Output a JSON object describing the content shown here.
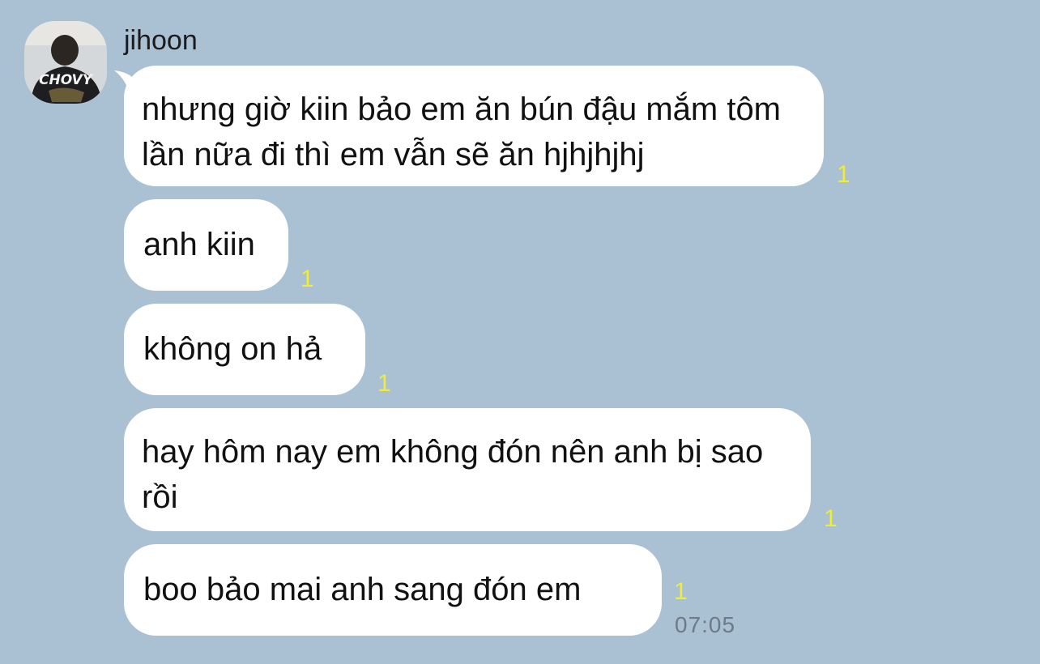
{
  "chat": {
    "sender_name": "jihoon",
    "avatar_label": "CHOVY",
    "messages": [
      {
        "text": "nhưng giờ kiin bảo em ăn bún đậu mắm tôm lần nữa đi thì em vẫn sẽ ăn hjhjhjhj",
        "unread": "1"
      },
      {
        "text": "anh kiin",
        "unread": "1"
      },
      {
        "text": "không on hả",
        "unread": "1"
      },
      {
        "text": "hay hôm nay em không đón nên anh bị sao rồi",
        "unread": "1"
      },
      {
        "text": "boo bảo mai anh sang đón em",
        "unread": "1",
        "time": "07:05"
      }
    ]
  },
  "colors": {
    "background": "#aac0d3",
    "bubble": "#ffffff",
    "unread": "#f0ec3a",
    "time": "#6c7b89"
  }
}
